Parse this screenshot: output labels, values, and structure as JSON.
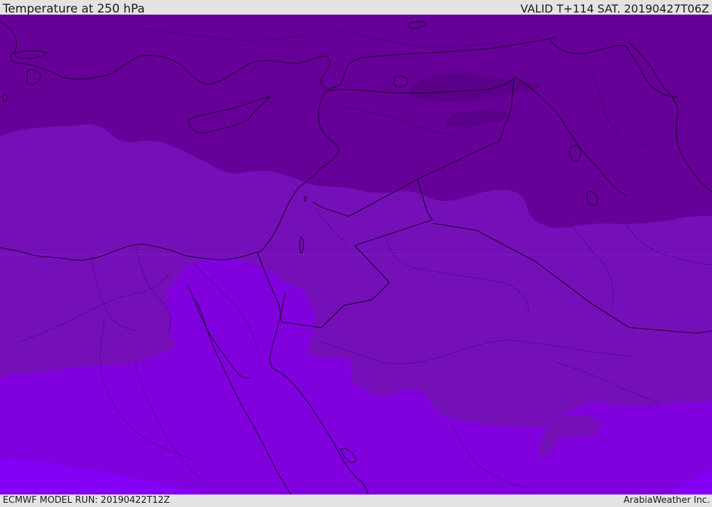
{
  "header": {
    "title": "Temperature at 250 hPa",
    "valid": "VALID T+114 SAT. 20190427T06Z"
  },
  "footer": {
    "model_run": "ECMWF MODEL RUN: 20190422T12Z",
    "brand": "ArabiaWeather Inc."
  },
  "map": {
    "shading_colors": {
      "darkest": "#5a0088",
      "dark": "#670098",
      "mid": "#7510b8",
      "light": "#8000de",
      "lightest": "#8400f5"
    },
    "line_color": "#1a0030"
  }
}
